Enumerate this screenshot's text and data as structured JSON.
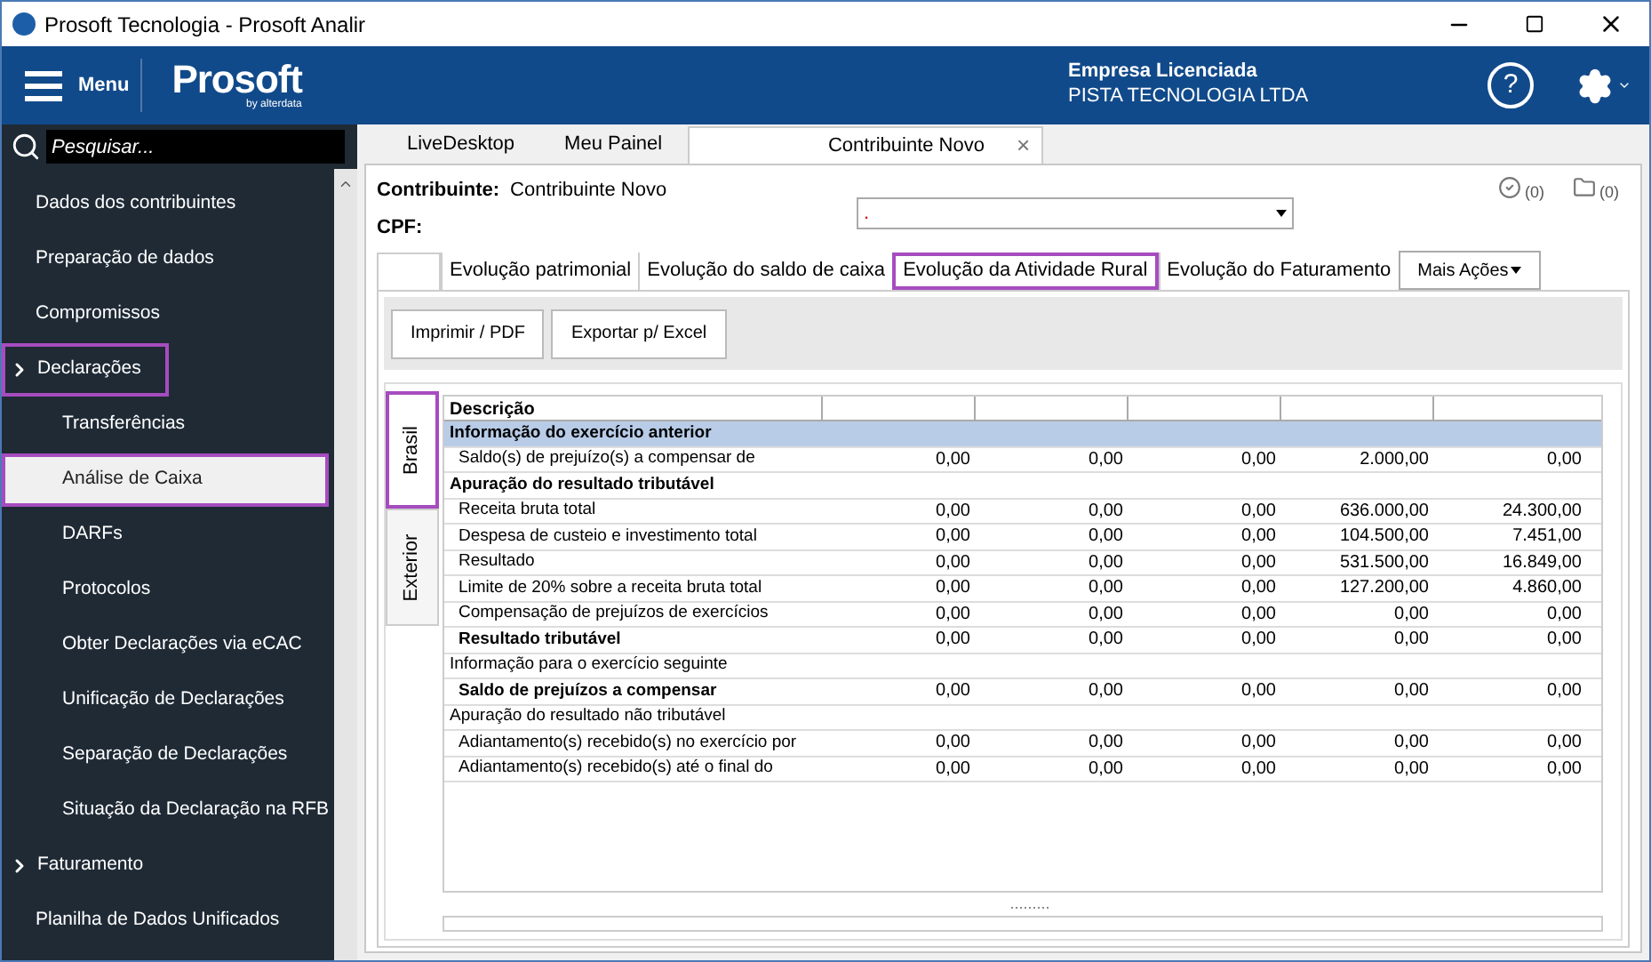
{
  "window": {
    "title": "Prosoft Tecnologia - Prosoft Analir"
  },
  "header": {
    "menu_label": "Menu",
    "logo": "Prosoft",
    "logo_sub": "by alterdata",
    "company_label": "Empresa Licenciada",
    "company_name": "PISTA TECNOLOGIA LTDA",
    "help": "?"
  },
  "search": {
    "placeholder": "Pesquisar..."
  },
  "sidebar": {
    "items": [
      {
        "label": "Dados dos contribuintes",
        "kind": "top",
        "selected": false,
        "highlighted": false
      },
      {
        "label": "Preparação de dados",
        "kind": "top",
        "selected": false,
        "highlighted": false
      },
      {
        "label": "Compromissos",
        "kind": "top",
        "selected": false,
        "highlighted": false
      },
      {
        "label": "Declarações",
        "kind": "group",
        "selected": false,
        "highlighted": true
      },
      {
        "label": "Transferências",
        "kind": "sub",
        "selected": false,
        "highlighted": false
      },
      {
        "label": "Análise de Caixa",
        "kind": "sub",
        "selected": true,
        "highlighted": true
      },
      {
        "label": "DARFs",
        "kind": "sub",
        "selected": false,
        "highlighted": false
      },
      {
        "label": "Protocolos",
        "kind": "sub",
        "selected": false,
        "highlighted": false
      },
      {
        "label": "Obter Declarações via eCAC",
        "kind": "sub",
        "selected": false,
        "highlighted": false
      },
      {
        "label": "Unificação de Declarações",
        "kind": "sub",
        "selected": false,
        "highlighted": false
      },
      {
        "label": "Separação de Declarações",
        "kind": "sub",
        "selected": false,
        "highlighted": false
      },
      {
        "label": "Situação da Declaração na RFB",
        "kind": "sub",
        "selected": false,
        "highlighted": false
      },
      {
        "label": "Faturamento",
        "kind": "group",
        "selected": false,
        "highlighted": false
      },
      {
        "label": "Planilha de Dados Unificados",
        "kind": "top",
        "selected": false,
        "highlighted": false
      }
    ]
  },
  "doc_tabs": [
    {
      "label": "LiveDesktop",
      "selected": false,
      "closable": false
    },
    {
      "label": "Meu Painel",
      "selected": false,
      "closable": false
    },
    {
      "label": "Contribuinte Novo",
      "selected": true,
      "closable": true
    }
  ],
  "close_glyph": "×",
  "contribuinte": {
    "label": "Contribuinte:",
    "value": "Contribuinte Novo",
    "cpf_label": "CPF:",
    "select_value": ".",
    "checks_count": "(0)",
    "folders_count": "(0)"
  },
  "tabs": [
    {
      "selected": false
    },
    {
      "label": "Evolução patrimonial",
      "selected": false
    },
    {
      "label": "Evolução do saldo de caixa",
      "selected": false
    },
    {
      "label": "Evolução da Atividade Rural",
      "selected": true
    },
    {
      "label": "Evolução do Faturamento",
      "selected": false
    }
  ],
  "more_actions": "Mais Ações",
  "buttons": [
    "Imprimir / PDF",
    "Exportar p/ Excel"
  ],
  "side_tabs": [
    {
      "label": "Brasil",
      "selected": true
    },
    {
      "label": "Exterior",
      "selected": false
    }
  ],
  "table": {
    "columns": [
      "Descrição"
    ],
    "rows": [
      {
        "kind": "group",
        "label": "Informação do exercício anterior"
      },
      {
        "kind": "item",
        "label": "Saldo(s) de prejuízo(s) a compensar de",
        "values": [
          "0,00",
          "0,00",
          "0,00",
          "2.000,00",
          "0,00"
        ]
      },
      {
        "kind": "heading",
        "label": "Apuração do resultado tributável"
      },
      {
        "kind": "item",
        "label": "Receita bruta total",
        "values": [
          "0,00",
          "0,00",
          "0,00",
          "636.000,00",
          "24.300,00"
        ]
      },
      {
        "kind": "item",
        "label": "Despesa de custeio e investimento total",
        "values": [
          "0,00",
          "0,00",
          "0,00",
          "104.500,00",
          "7.451,00"
        ]
      },
      {
        "kind": "item",
        "label": "Resultado",
        "values": [
          "0,00",
          "0,00",
          "0,00",
          "531.500,00",
          "16.849,00"
        ]
      },
      {
        "kind": "item",
        "label": "Limite de 20% sobre a receita bruta total",
        "values": [
          "0,00",
          "0,00",
          "0,00",
          "127.200,00",
          "4.860,00"
        ]
      },
      {
        "kind": "item",
        "label": "Compensação de prejuízos de exercícios",
        "values": [
          "0,00",
          "0,00",
          "0,00",
          "0,00",
          "0,00"
        ]
      },
      {
        "kind": "total",
        "label": "Resultado tributável",
        "values": [
          "0,00",
          "0,00",
          "0,00",
          "0,00",
          "0,00"
        ]
      },
      {
        "kind": "label",
        "label": "Informação para o exercício seguinte"
      },
      {
        "kind": "total",
        "label": "Saldo de prejuízos a compensar",
        "values": [
          "0,00",
          "0,00",
          "0,00",
          "0,00",
          "0,00"
        ]
      },
      {
        "kind": "label",
        "label": "Apuração do resultado não tributável"
      },
      {
        "kind": "item",
        "label": "Adiantamento(s) recebido(s) no exercício por",
        "values": [
          "0,00",
          "0,00",
          "0,00",
          "0,00",
          "0,00"
        ]
      },
      {
        "kind": "item",
        "label": "Adiantamento(s) recebido(s) até o final do",
        "values": [
          "0,00",
          "0,00",
          "0,00",
          "0,00",
          "0,00"
        ]
      }
    ]
  },
  "splitter": "........."
}
